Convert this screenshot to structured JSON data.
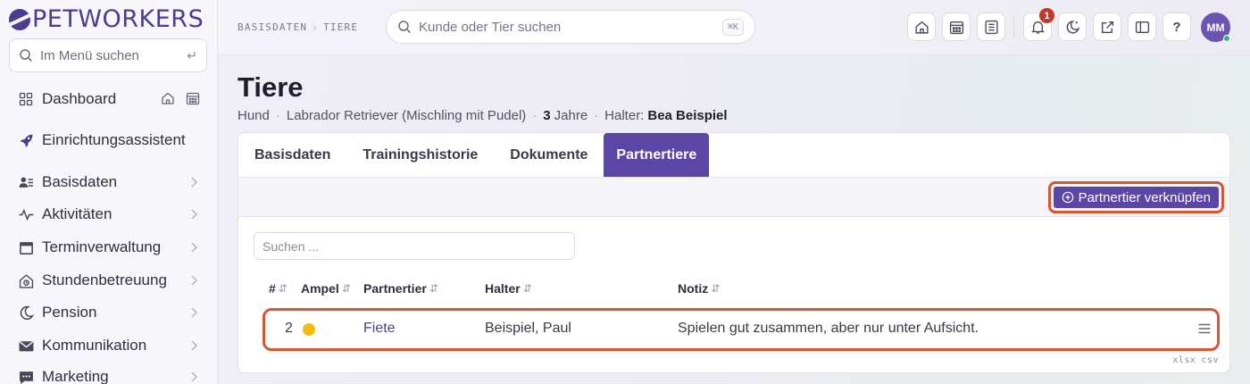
{
  "app": {
    "logo_text": "PETWORKERS"
  },
  "sidebar": {
    "search_placeholder": "Im Menü suchen",
    "items": [
      {
        "label": "Dashboard",
        "icon": "dashboard-icon"
      },
      {
        "label": "Einrichtungsassistent",
        "icon": "rocket-icon"
      },
      {
        "label": "Basisdaten",
        "icon": "users-list-icon"
      },
      {
        "label": "Aktivitäten",
        "icon": "activity-icon"
      },
      {
        "label": "Terminverwaltung",
        "icon": "calendar-icon"
      },
      {
        "label": "Stundenbetreuung",
        "icon": "house-clock-icon"
      },
      {
        "label": "Pension",
        "icon": "moon-icon"
      },
      {
        "label": "Kommunikation",
        "icon": "envelope-icon"
      },
      {
        "label": "Marketing",
        "icon": "chat-icon"
      }
    ]
  },
  "topbar": {
    "breadcrumb": [
      "BASISDATEN",
      "TIERE"
    ],
    "search_placeholder": "Kunde oder Tier suchen",
    "search_shortcut": "⌘K",
    "notification_count": "1",
    "avatar_initials": "MM",
    "help_label": "?"
  },
  "page": {
    "title": "Tiere",
    "species": "Hund",
    "breed": "Labrador Retriever (Mischling mit Pudel)",
    "age_value": "3",
    "age_unit": "Jahre",
    "owner_label": "Halter:",
    "owner_name": "Bea Beispiel"
  },
  "tabs": [
    {
      "label": "Basisdaten",
      "active": false
    },
    {
      "label": "Trainingshistorie",
      "active": false
    },
    {
      "label": "Dokumente",
      "active": false
    },
    {
      "label": "Partnertiere",
      "active": true
    }
  ],
  "actions": {
    "link_partner_label": "Partnertier verknüpfen"
  },
  "table": {
    "search_placeholder": "Suchen ...",
    "columns": [
      "#",
      "Ampel",
      "Partnertier",
      "Halter",
      "Notiz"
    ],
    "rows": [
      {
        "num": "2",
        "ampel_color": "#f2bd0f",
        "partner": "Fiete",
        "owner": "Beispiel, Paul",
        "note": "Spielen gut zusammen, aber nur unter Aufsicht."
      }
    ],
    "exports": [
      "xlsx",
      "csv"
    ]
  },
  "colors": {
    "brand": "#5b46a6",
    "highlight": "#d4572f"
  }
}
